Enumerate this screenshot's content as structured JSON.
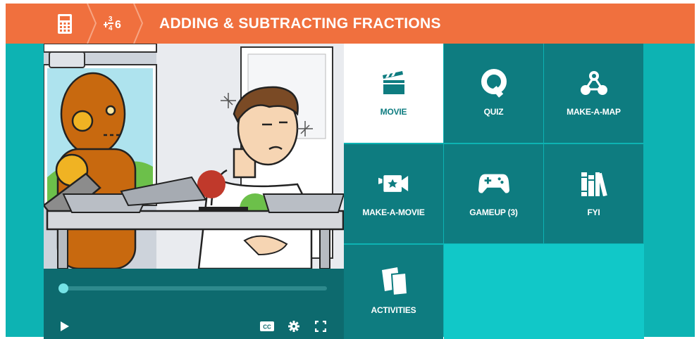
{
  "header": {
    "title": "ADDING & SUBTRACTING FRACTIONS",
    "calculator_icon": "calculator-icon",
    "fractions_icon": "fractions-icon",
    "fractions_icon_text": {
      "n1": "3",
      "d1": "4",
      "n2": "6"
    }
  },
  "video": {
    "progress_fraction": 0.0,
    "controls": [
      "play-icon",
      "closed-captions-icon",
      "settings-gear-icon",
      "fullscreen-icon"
    ],
    "cc_label": "CC"
  },
  "tiles": [
    {
      "id": "movie",
      "label": "MOVIE",
      "icon": "movie-clapper-icon",
      "active": true
    },
    {
      "id": "quiz",
      "label": "QUIZ",
      "icon": "quiz-q-icon",
      "active": false
    },
    {
      "id": "make-a-map",
      "label": "MAKE-A-MAP",
      "icon": "concept-map-icon",
      "active": false
    },
    {
      "id": "make-a-movie",
      "label": "MAKE-A-MOVIE",
      "icon": "video-camera-star-icon",
      "active": false
    },
    {
      "id": "gameup",
      "label": "GAMEUP (3)",
      "icon": "game-controller-icon",
      "active": false
    },
    {
      "id": "fyi",
      "label": "FYI",
      "icon": "books-icon",
      "active": false
    },
    {
      "id": "activities",
      "label": "ACTIVITIES",
      "icon": "activities-pages-icon",
      "active": false
    }
  ],
  "colors": {
    "header": "#f0703e",
    "background": "#0db3b3",
    "tile": "#0e7c80",
    "tile_active": "#ffffff",
    "empty": "#11c8c8"
  }
}
